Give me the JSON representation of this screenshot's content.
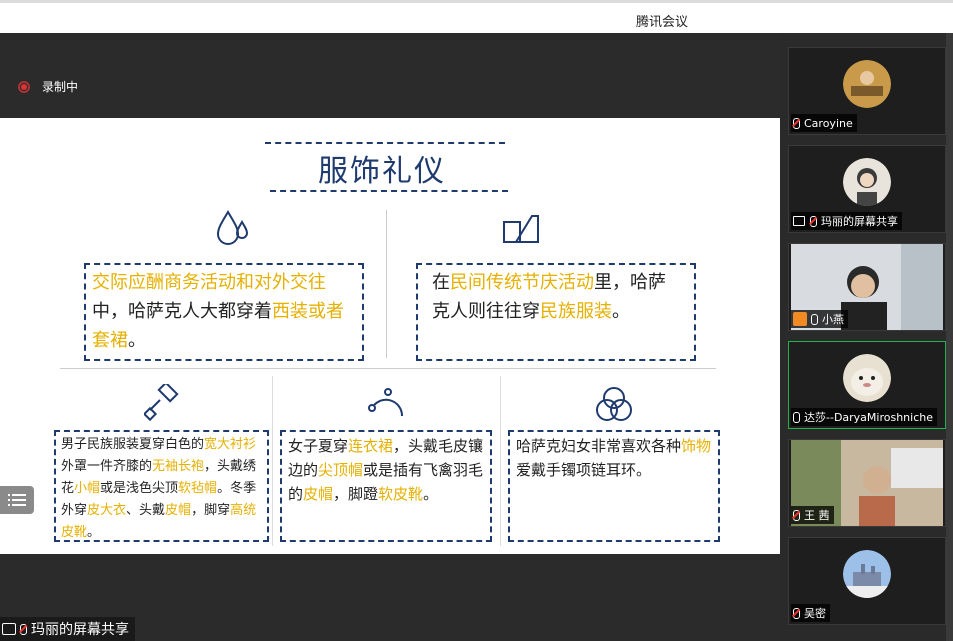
{
  "app": {
    "title": "腾讯会议"
  },
  "recording": {
    "label": "录制中"
  },
  "slide": {
    "title": "服饰礼仪",
    "box1": {
      "t1": "交际应酬商务活动和对外交往",
      "t2": "中，哈萨克人大都穿着",
      "t3": "西装或者套裙",
      "t4": "。"
    },
    "box2": {
      "t1": "在",
      "t2": "民间传统节庆活动",
      "t3": "里，哈萨克人则往往穿",
      "t4": "民族服装",
      "t5": "。"
    },
    "box3": {
      "t1": "男子民族服装夏穿白色的",
      "t2": "宽大衬衫",
      "t3": "外罩一件齐膝的",
      "t4": "无袖长袍",
      "t5": "，头戴绣花",
      "t6": "小帽",
      "t7": "或是浅色尖顶",
      "t8": "软毡帽",
      "t9": "。冬季外穿",
      "t10": "皮大衣",
      "t11": "、头戴",
      "t12": "皮帽",
      "t13": "，脚穿",
      "t14": "高统皮靴",
      "t15": "。"
    },
    "box4": {
      "t1": "女子夏穿",
      "t2": "连衣裙",
      "t3": "，头戴毛皮镶边的",
      "t4": "尖顶帽",
      "t5": "或是插有飞禽羽毛的",
      "t6": "皮帽",
      "t7": "，脚蹬",
      "t8": "软皮靴",
      "t9": "。"
    },
    "box5": {
      "t1": "哈萨克妇女非常喜欢各种",
      "t2": "饰物",
      "t3": "爱戴手镯项链耳环。"
    }
  },
  "share_label": "玛丽的屏幕共享",
  "participants": [
    {
      "name": "Caroyine"
    },
    {
      "name": "玛丽的屏幕共享"
    },
    {
      "name": "小燕"
    },
    {
      "name": "达莎--DaryaMiroshniche"
    },
    {
      "name": "王 茜"
    },
    {
      "name": "吴密"
    }
  ],
  "colors": {
    "accent": "#1e3a6e",
    "highlight": "#e6b000",
    "active_speaker": "#25b050"
  }
}
